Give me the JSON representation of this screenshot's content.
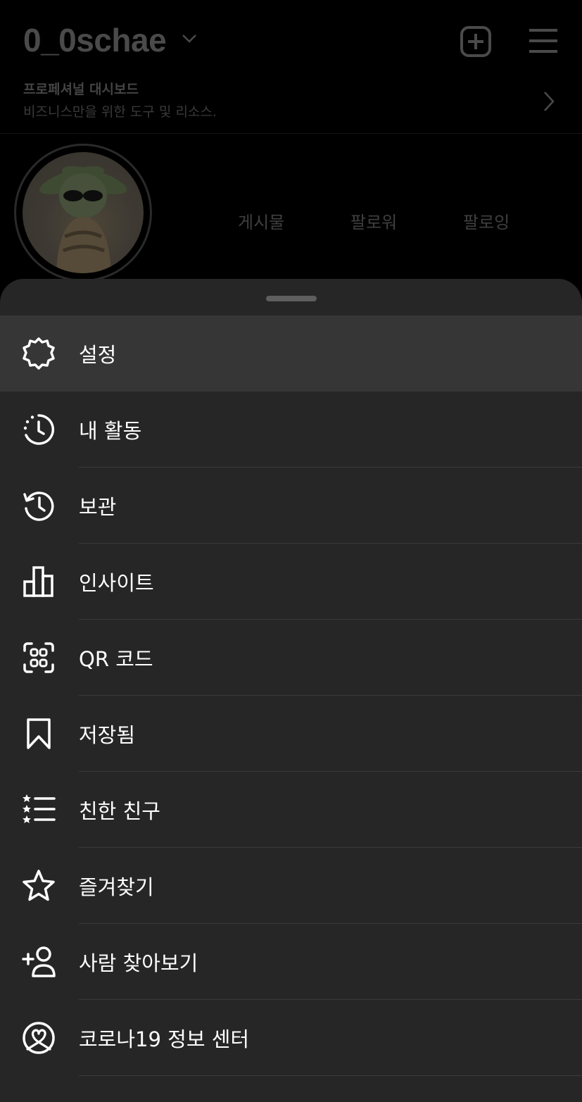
{
  "header": {
    "username": "0_0schae",
    "dashboard_title": "프로페셔널 대시보드",
    "dashboard_subtitle": "비즈니스만을 위한 도구 및 리소스."
  },
  "profile": {
    "stats": {
      "posts_label": "게시물",
      "followers_label": "팔로워",
      "following_label": "팔로잉"
    }
  },
  "menu": {
    "items": [
      {
        "label": "설정",
        "icon": "settings-gear-icon",
        "active": true
      },
      {
        "label": "내 활동",
        "icon": "activity-clock-icon"
      },
      {
        "label": "보관",
        "icon": "archive-history-icon"
      },
      {
        "label": "인사이트",
        "icon": "insights-bar-chart-icon"
      },
      {
        "label": "QR 코드",
        "icon": "qr-code-icon"
      },
      {
        "label": "저장됨",
        "icon": "bookmark-icon"
      },
      {
        "label": "친한 친구",
        "icon": "close-friends-list-icon"
      },
      {
        "label": "즐겨찾기",
        "icon": "star-icon"
      },
      {
        "label": "사람 찾아보기",
        "icon": "add-person-icon"
      },
      {
        "label": "코로나19 정보 센터",
        "icon": "heart-circle-icon"
      }
    ]
  },
  "colors": {
    "sheet_background": "#262626",
    "active_row": "#363636",
    "background": "#000000"
  }
}
